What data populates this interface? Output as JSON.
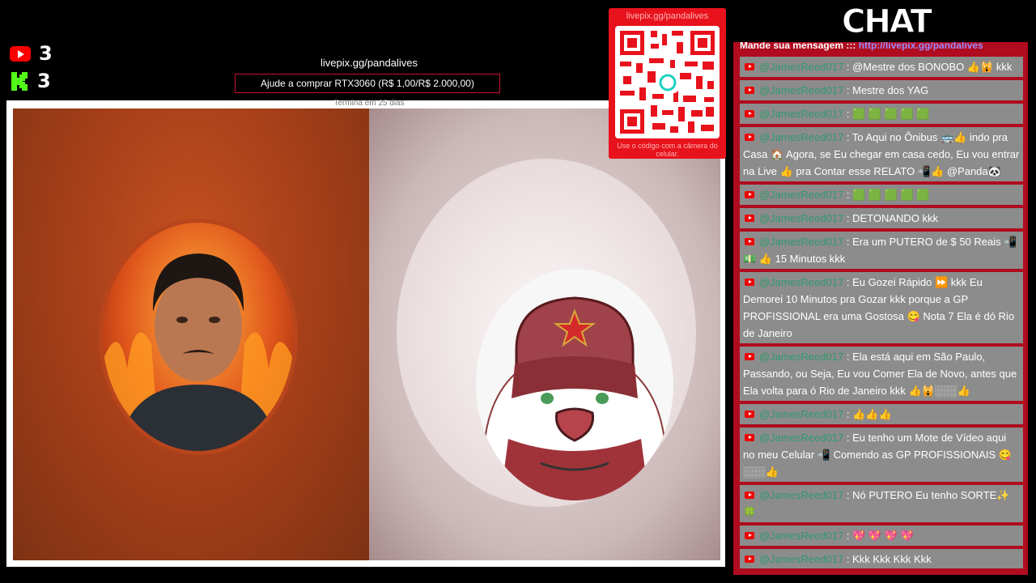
{
  "counters": {
    "youtube": {
      "icon": "youtube-icon",
      "value": "3"
    },
    "kick": {
      "icon": "kick-icon",
      "value": "3"
    }
  },
  "donation": {
    "url": "livepix.gg/pandalives",
    "goal": "Ajude a comprar RTX3060 (R$ 1,00/R$ 2.000,00)",
    "subtitle": "Termina em 25 dias"
  },
  "qr": {
    "url": "livepix.gg/pandalives",
    "hint": "Use o código com a câmera do celular."
  },
  "chat": {
    "title": "CHAT",
    "prompt": "Mande sua mensagem ::: ",
    "prompt_link": "http://livepix.gg/pandalives",
    "messages": [
      {
        "user": "@JamesReed017",
        "text": "@Mestre dos BONOBO 👍🙀 kkk"
      },
      {
        "user": "@JamesReed017",
        "text": "Mestre dos YAG"
      },
      {
        "user": "@JamesReed017",
        "text": "🟩 🟩 🟩 🟩 🟩"
      },
      {
        "user": "@JamesReed017",
        "text": "To Aqui no Ônibus 🚌👍 indo pra Casa 🏠 Agora, se Eu chegar em casa cedo, Eu vou entrar na Live 👍 pra Contar esse RELATO 📲👍 @Panda🐼"
      },
      {
        "user": "@JamesReed017",
        "text": "🟩 🟩 🟩 🟩 🟩"
      },
      {
        "user": "@JamesReed017",
        "text": "DETONANDO kkk"
      },
      {
        "user": "@JamesReed017",
        "text": "Era um PUTERO de $ 50 Reais 📲💵 👍 15 Minutos kkk"
      },
      {
        "user": "@JamesReed017",
        "text": "Eu Gozei Rápido ⏩ kkk Eu Demorei 10 Minutos pra Gozar kkk porque a GP PROFISSIONAL era uma Gostosa 😋 Nota 7 Ela é dó Rio de Janeiro"
      },
      {
        "user": "@JamesReed017",
        "text": "Ela está aqui em São Paulo, Passando, ou Seja, Eu vou Comer Ela de Novo, antes que Ela volta para ó Rio de Janeiro kkk 👍🙀░░░👍"
      },
      {
        "user": "@JamesReed017",
        "text": "👍👍👍"
      },
      {
        "user": "@JamesReed017",
        "text": "Eu tenho um Mote de Vídeo aqui no meu Celular 📲 Comendo as GP PROFISSIONAIS 😋░░░👍"
      },
      {
        "user": "@JamesReed017",
        "text": "Nó PUTERO Eu tenho SORTE✨🍀"
      },
      {
        "user": "@JamesReed017",
        "text": "💖 💖 💖 💖"
      },
      {
        "user": "@JamesReed017",
        "text": "Kkk Kkk Kkk Kkk"
      }
    ]
  }
}
